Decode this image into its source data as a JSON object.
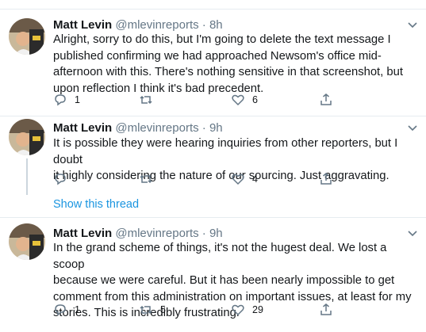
{
  "tweets": [
    {
      "name": "Matt Levin",
      "handle": "@mlevinreports",
      "sep": "·",
      "time": "8h",
      "text": "Alright, sorry to do this, but I'm going to delete the text message I\npublished confirming we had approached Newsom's office mid-\nafternoon with this. There's nothing sensitive in that screenshot, but\nupon reflection I think it's bad precedent.",
      "reply_count": "1",
      "retweet_count": "",
      "like_count": "6"
    },
    {
      "name": "Matt Levin",
      "handle": "@mlevinreports",
      "sep": "·",
      "time": "9h",
      "text": "It is possible they were hearing inquiries from other reporters, but I doubt\nit highly considering the nature of our sourcing. Just aggravating.",
      "reply_count": "",
      "retweet_count": "",
      "like_count": "4"
    },
    {
      "name": "Matt Levin",
      "handle": "@mlevinreports",
      "sep": "·",
      "time": "9h",
      "text": "In the grand scheme of things, it's not the hugest deal. We lost a scoop\nbecause we were careful. But it has been nearly impossible to get\ncomment from this administration on important issues, at least for my\nstories. This is incredibly frustrating.",
      "reply_count": "1",
      "retweet_count": "5",
      "like_count": "29"
    }
  ],
  "show_thread_label": "Show this thread",
  "icons": {
    "reply": "reply-icon",
    "retweet": "retweet-icon",
    "like": "heart-icon",
    "share": "share-icon",
    "more": "chevron-down-icon"
  },
  "colors": {
    "icon_gray": "#657786",
    "link_blue": "#1b95e0",
    "divider": "#e6ecf0"
  }
}
